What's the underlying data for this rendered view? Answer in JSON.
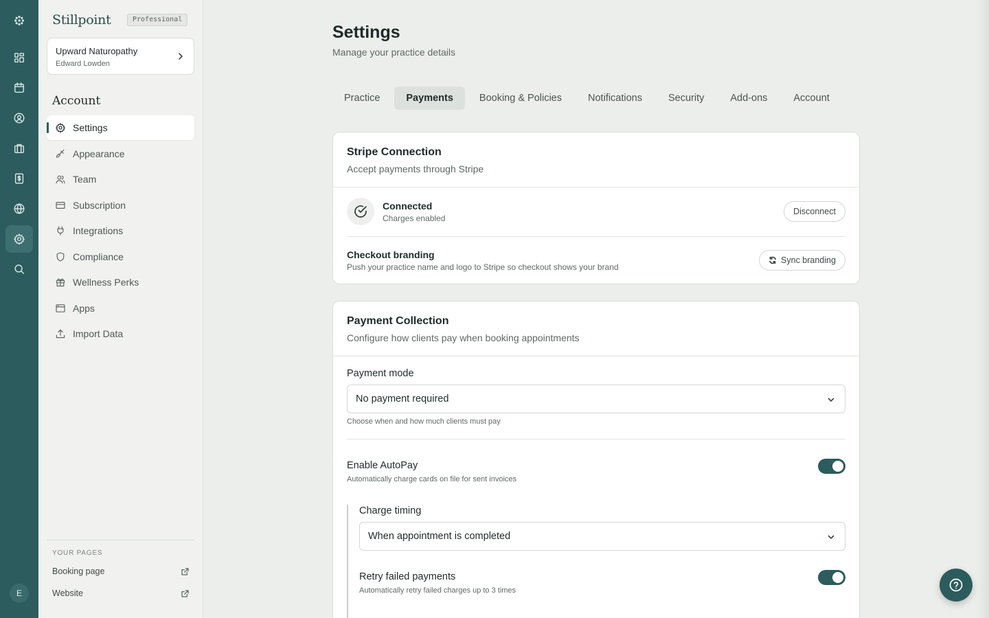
{
  "app": {
    "brand": "Stillpoint",
    "plan_badge": "Professional"
  },
  "practice": {
    "name": "Upward Naturopathy",
    "owner": "Edward Lowden"
  },
  "rail": {
    "avatar_initial": "E"
  },
  "sidebar": {
    "section_title": "Account",
    "items": [
      {
        "label": "Settings",
        "icon": "gear-icon"
      },
      {
        "label": "Appearance",
        "icon": "paintbrush-icon"
      },
      {
        "label": "Team",
        "icon": "users-icon"
      },
      {
        "label": "Subscription",
        "icon": "credit-card-icon"
      },
      {
        "label": "Integrations",
        "icon": "plug-icon"
      },
      {
        "label": "Compliance",
        "icon": "shield-icon"
      },
      {
        "label": "Wellness Perks",
        "icon": "gift-icon"
      },
      {
        "label": "Apps",
        "icon": "window-icon"
      },
      {
        "label": "Import Data",
        "icon": "upload-icon"
      }
    ],
    "your_pages_label": "YOUR PAGES",
    "pages": [
      {
        "label": "Booking page"
      },
      {
        "label": "Website"
      }
    ]
  },
  "header": {
    "title": "Settings",
    "subtitle": "Manage your practice details"
  },
  "tabs": [
    {
      "label": "Practice"
    },
    {
      "label": "Payments"
    },
    {
      "label": "Booking & Policies"
    },
    {
      "label": "Notifications"
    },
    {
      "label": "Security"
    },
    {
      "label": "Add-ons"
    },
    {
      "label": "Account"
    }
  ],
  "stripe": {
    "title": "Stripe Connection",
    "description": "Accept payments through Stripe",
    "status": "Connected",
    "status_detail": "Charges enabled",
    "disconnect_label": "Disconnect",
    "branding_title": "Checkout branding",
    "branding_desc": "Push your practice name and logo to Stripe so checkout shows your brand",
    "sync_label": "Sync branding"
  },
  "payments": {
    "title": "Payment Collection",
    "description": "Configure how clients pay when booking appointments",
    "mode_label": "Payment mode",
    "mode_value": "No payment required",
    "mode_help": "Choose when and how much clients must pay",
    "autopay_label": "Enable AutoPay",
    "autopay_desc": "Automatically charge cards on file for sent invoices",
    "autopay_enabled": true,
    "timing_label": "Charge timing",
    "timing_value": "When appointment is completed",
    "retry_label": "Retry failed payments",
    "retry_desc": "Automatically retry failed charges up to 3 times",
    "retry_enabled": true
  },
  "colors": {
    "accent": "#2c5c5e",
    "rail": "#2c5c5e",
    "background": "#eceeeb"
  }
}
